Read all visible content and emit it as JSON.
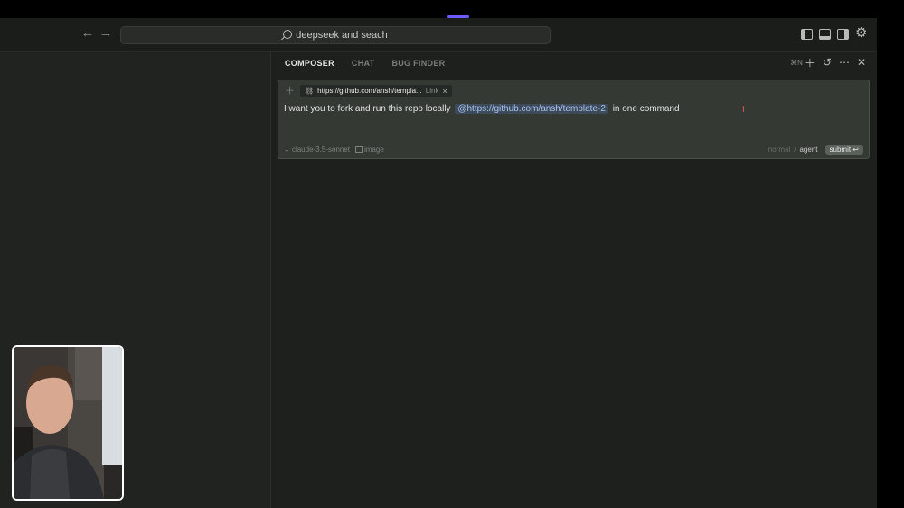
{
  "window": {
    "search_text": "deepseek and seach"
  },
  "panel": {
    "tabs": [
      {
        "label": "COMPOSER",
        "active": true
      },
      {
        "label": "CHAT",
        "active": false
      },
      {
        "label": "BUG FINDER",
        "active": false
      }
    ],
    "shortcut": "⌘N"
  },
  "composer": {
    "attachment": {
      "label": "https://github.com/ansh/templa...",
      "type": "Link"
    },
    "prompt_before": "I want you to fork and run this repo locally",
    "mention": "@https://github.com/ansh/template-2",
    "prompt_after": "in one command",
    "model": "claude-3.5-sonnet",
    "image_label": "image",
    "mode_normal": "normal",
    "mode_sep": "/",
    "mode_agent": "agent",
    "submit_label": "submit ↩"
  }
}
